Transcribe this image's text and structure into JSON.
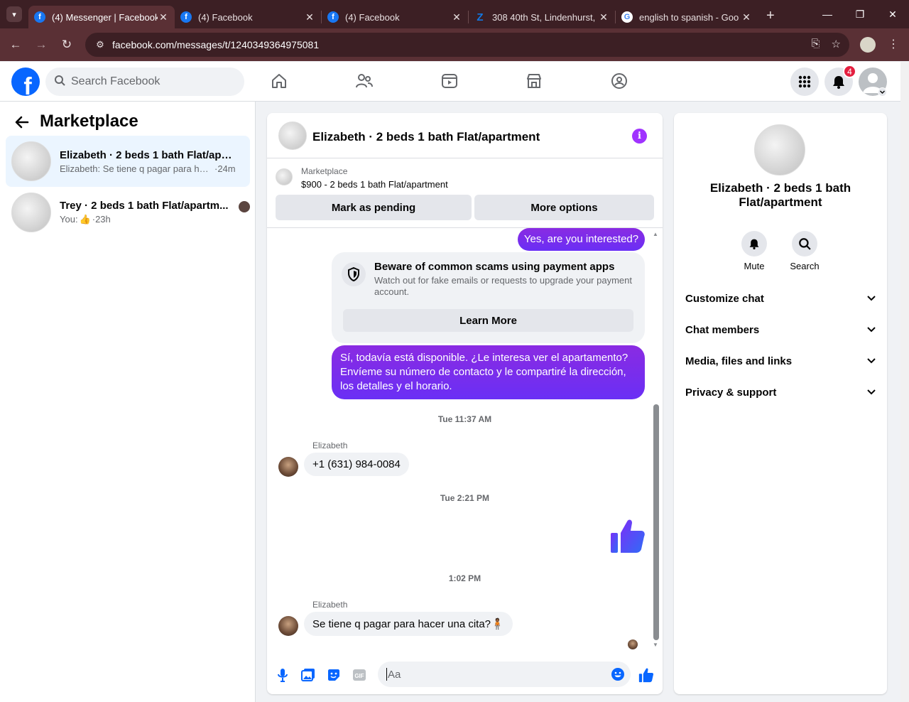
{
  "browser": {
    "tabs": [
      {
        "title": "(4) Messenger | Facebook",
        "icon": "facebook-icon",
        "active": true
      },
      {
        "title": "(4) Facebook",
        "icon": "facebook-icon",
        "active": false
      },
      {
        "title": "(4) Facebook",
        "icon": "facebook-icon",
        "active": false
      },
      {
        "title": "308 40th St, Lindenhurst,",
        "icon": "zillow-icon",
        "active": false
      },
      {
        "title": "english to spanish - Goo",
        "icon": "google-icon",
        "active": false
      }
    ],
    "url": "facebook.com/messages/t/1240349364975081"
  },
  "header": {
    "search_placeholder": "Search Facebook",
    "notification_count": "4"
  },
  "sidebar": {
    "title": "Marketplace",
    "conversations": [
      {
        "name": "Elizabeth · 2 beds 1 bath Flat/apart...",
        "snippet": "Elizabeth: Se tiene q pagar para hac...",
        "time": "·24m",
        "active": true
      },
      {
        "name": "Trey · 2 beds 1 bath Flat/apartm...",
        "snippet": "You: ",
        "time": "·23h",
        "active": false
      }
    ]
  },
  "chat": {
    "title": "Elizabeth · 2 beds 1 bath Flat/apartment",
    "marketplace_label": "Marketplace",
    "listing": "$900 - 2 beds 1 bath Flat/apartment",
    "mark_pending": "Mark as pending",
    "more_options": "More options",
    "messages": {
      "out1": "Yes, are you interested?",
      "notice_title": "Beware of common scams using payment apps",
      "notice_body": "Watch out for fake emails or requests to upgrade your payment account.",
      "learn_more": "Learn More",
      "out2": "Sí, todavía está disponible. ¿Le interesa ver el apartamento? Envíeme su número de contacto y le compartiré la dirección, los detalles y el horario.",
      "ts1": "Tue 11:37 AM",
      "sender1": "Elizabeth",
      "in1": "+1 (631) 984-0084",
      "ts2": "Tue 2:21 PM",
      "ts3": "1:02 PM",
      "sender2": "Elizabeth",
      "in2": "Se tiene q pagar para hacer una cita?🧍🏾"
    },
    "composer_placeholder": "Aa"
  },
  "details": {
    "name": "Elizabeth · 2 beds 1 bath Flat/apartment",
    "actions": {
      "mute": "Mute",
      "search": "Search"
    },
    "sections": [
      "Customize chat",
      "Chat members",
      "Media, files and links",
      "Privacy & support"
    ]
  },
  "colors": {
    "brand": "#0866ff",
    "outgoing": "#7b2ff7",
    "info": "#a033ff"
  }
}
